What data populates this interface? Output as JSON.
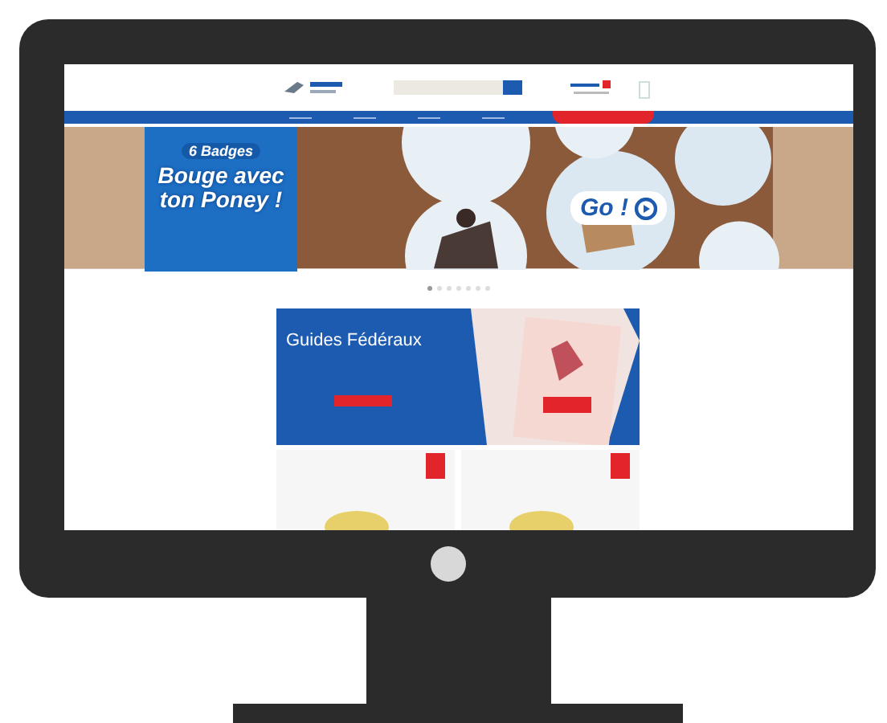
{
  "nav": {
    "items": [
      {
        "kind": "link"
      },
      {
        "kind": "link"
      },
      {
        "kind": "link"
      },
      {
        "kind": "link"
      },
      {
        "kind": "highlight"
      }
    ]
  },
  "banner": {
    "kicker": "6 Badges",
    "headline": "Bouge avec ton Poney !",
    "cta": "Go !",
    "slides": [
      {
        "selected": true
      },
      {
        "selected": false
      },
      {
        "selected": false
      },
      {
        "selected": false
      },
      {
        "selected": false
      },
      {
        "selected": false
      },
      {
        "selected": false
      }
    ]
  },
  "feature": {
    "title": "Guides Fédéraux"
  }
}
